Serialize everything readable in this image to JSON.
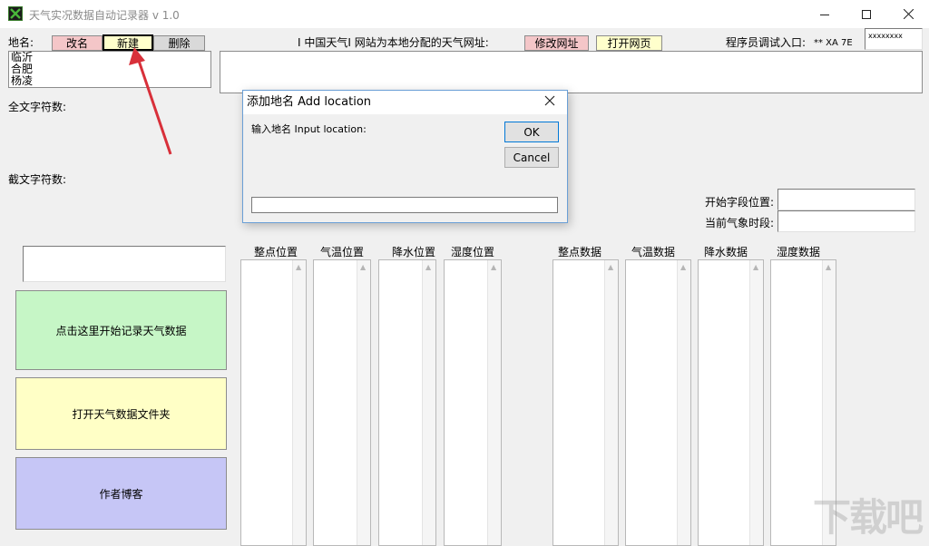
{
  "window": {
    "title": "天气实况数据自动记录器 v 1.0"
  },
  "toolbar": {
    "place_label": "地名:",
    "rename_label": "改名",
    "new_label": "新建",
    "delete_label": "删除",
    "china_weather_text": "I  中国天气I  网站为本地分配的天气网址:",
    "edit_url_label": "修改网址",
    "open_page_label": "打开网页",
    "debug_label": "程序员调试入口:",
    "debug_value": "** XA 7E",
    "debug_field_value": "xxxxxxxx"
  },
  "places": [
    "临沂",
    "合肥",
    "杨凌"
  ],
  "info": {
    "full_text_count_label": "全文字符数:",
    "cut_text_count_label": "截文字符数:",
    "start_field_pos_label": "开始字段位置:",
    "current_period_label": "当前气象时段:"
  },
  "columns": {
    "position": [
      "整点位置",
      "气温位置",
      "降水位置",
      "湿度位置"
    ],
    "data": [
      "整点数据",
      "气温数据",
      "降水数据",
      "湿度数据"
    ]
  },
  "actions": {
    "start_record_label": "点击这里开始记录天气数据",
    "open_folder_label": "打开天气数据文件夹",
    "blog_label": "作者博客"
  },
  "dialog": {
    "title": "添加地名 Add location",
    "prompt": "输入地名 Input location:",
    "ok_label": "OK",
    "cancel_label": "Cancel",
    "input_value": ""
  },
  "colors": {
    "rename_bg": "#f4c6c8",
    "new_bg": "#ffffcc",
    "delete_bg": "#d9d9d9",
    "edit_url_bg": "#f4c6c8",
    "open_page_bg": "#ffffcc",
    "start_btn_bg": "#c6f6c6",
    "folder_btn_bg": "#ffffc6",
    "blog_btn_bg": "#c6c6f6",
    "arrow": "#d8303a"
  },
  "watermark": "下载吧"
}
